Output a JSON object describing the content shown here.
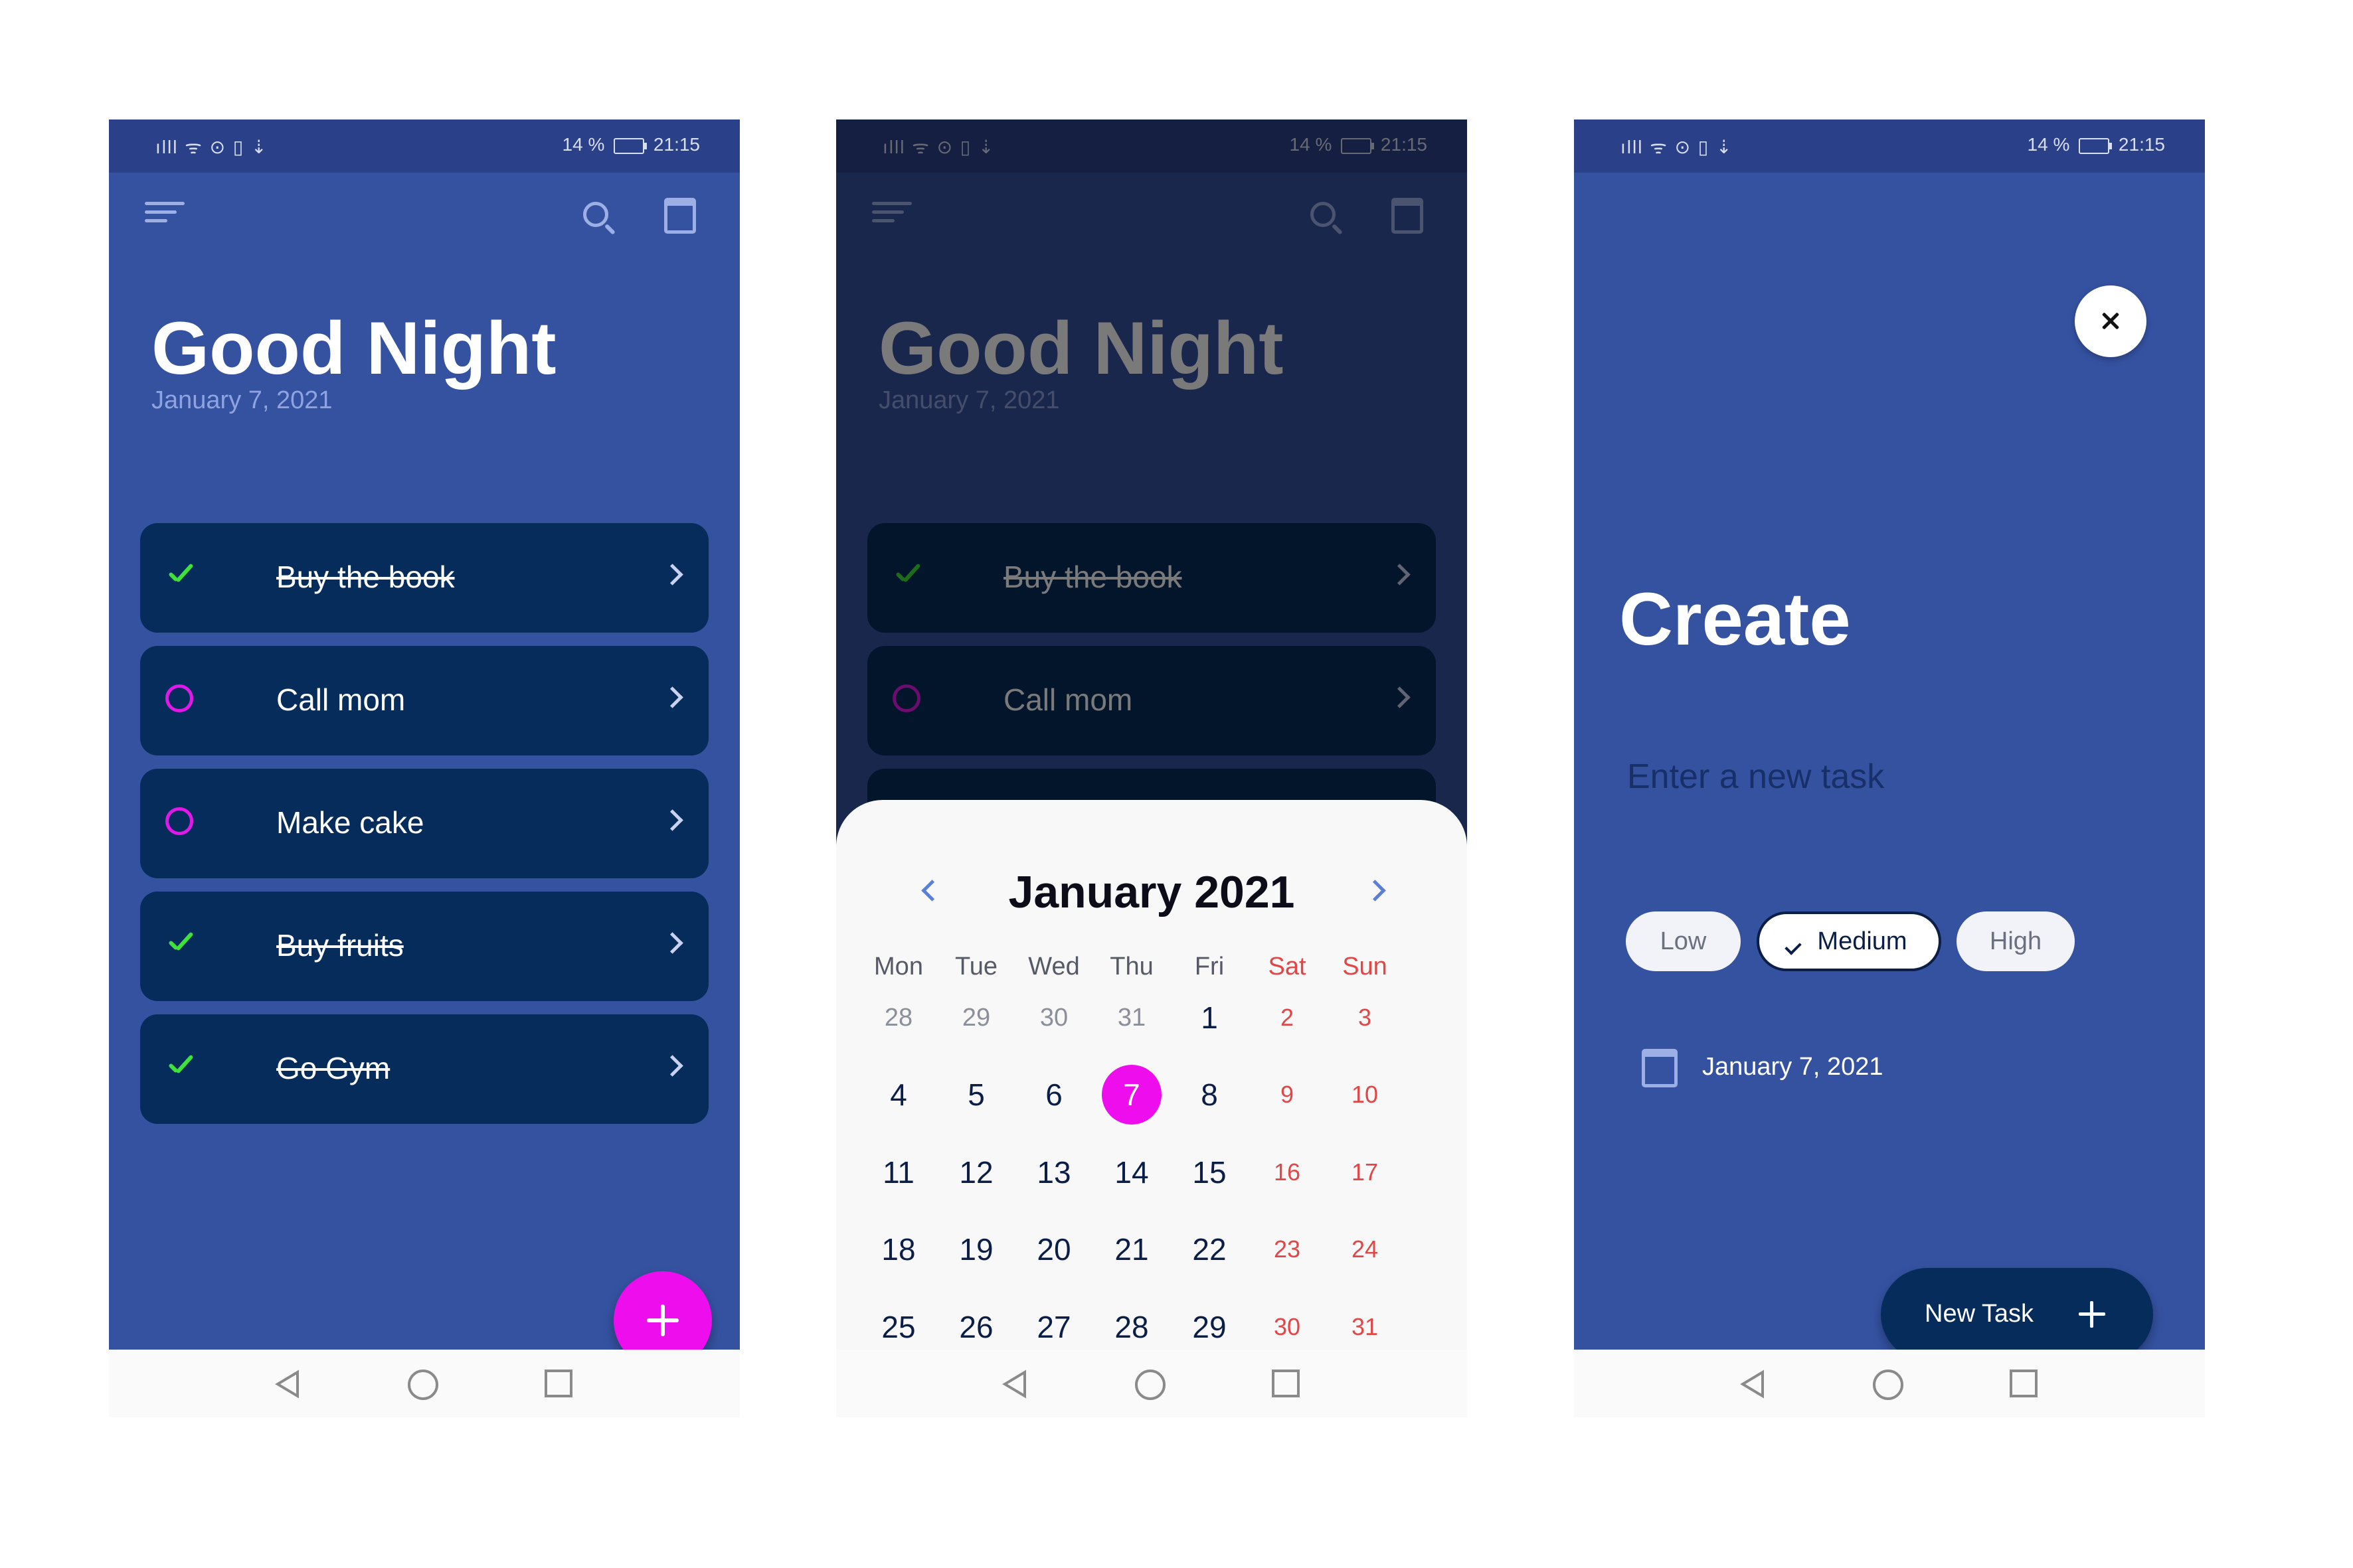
{
  "status_bar": {
    "signal_icons": "ılll ᯤ ⊙ ▯ ⇣",
    "battery_pct": "14 %",
    "time": "21:15"
  },
  "home": {
    "greeting": "Good Night",
    "date": "January 7, 2021",
    "tasks": [
      {
        "label": "Buy the book",
        "done": true
      },
      {
        "label": "Call mom",
        "done": false
      },
      {
        "label": "Make cake",
        "done": false
      },
      {
        "label": "Buy fruits",
        "done": true
      },
      {
        "label": "Go Gym",
        "done": true
      }
    ]
  },
  "calendar": {
    "month_title": "January 2021",
    "weekdays": [
      "Mon",
      "Tue",
      "Wed",
      "Thu",
      "Fri",
      "Sat",
      "Sun"
    ],
    "weeks": [
      [
        "28",
        "29",
        "30",
        "31",
        "1",
        "2",
        "3"
      ],
      [
        "4",
        "5",
        "6",
        "7",
        "8",
        "9",
        "10"
      ],
      [
        "11",
        "12",
        "13",
        "14",
        "15",
        "16",
        "17"
      ],
      [
        "18",
        "19",
        "20",
        "21",
        "22",
        "23",
        "24"
      ],
      [
        "25",
        "26",
        "27",
        "28",
        "29",
        "30",
        "31"
      ]
    ],
    "selected_day": "7"
  },
  "create": {
    "title": "Create",
    "input_placeholder": "Enter a new task",
    "priorities": [
      "Low",
      "Medium",
      "High"
    ],
    "selected_priority": "Medium",
    "date": "January 7, 2021",
    "button_label": "New Task"
  },
  "colors": {
    "primary_bg": "#3552a1",
    "card_bg": "#052c5a",
    "accent": "#ee0ded",
    "done_green": "#3ee23a",
    "weekend_red": "#e24747"
  }
}
